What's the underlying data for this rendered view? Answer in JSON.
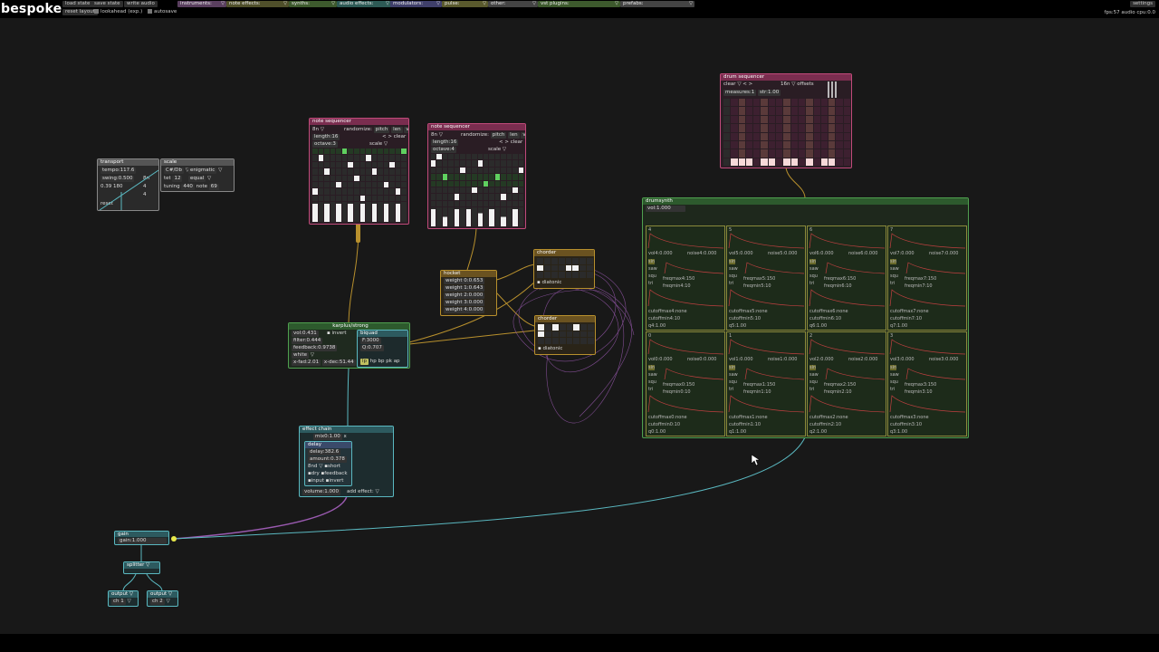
{
  "app": {
    "title": "bespoke"
  },
  "topbar": {
    "buttons": [
      "load state",
      "save state",
      "write audio",
      "reset layout"
    ],
    "checkboxes": [
      "lookahead (exp.)",
      "autosave"
    ],
    "categories": [
      {
        "label": "instruments:",
        "color": "#5a3f5f"
      },
      {
        "label": "note effects:",
        "color": "#4f4f2a"
      },
      {
        "label": "synths:",
        "color": "#3d5a2d"
      },
      {
        "label": "audio effects:",
        "color": "#2d5a55"
      },
      {
        "label": "modulators:",
        "color": "#3f3f6a"
      },
      {
        "label": "pulse:",
        "color": "#5a5a2d"
      },
      {
        "label": "other:",
        "color": "#444444"
      },
      {
        "label": "vst plugins:",
        "color": "#3d5a2d"
      },
      {
        "label": "prefabs:",
        "color": "#444444"
      }
    ],
    "settings_label": "settings",
    "status": "fps:57  audio cpu:0.0"
  },
  "transport": {
    "title": "transport",
    "tempo": "tempo:117.6",
    "swing": "swing:0.500",
    "time": "0.39 180",
    "div": "8n",
    "n1": "4",
    "n2": "4",
    "reset": "reset"
  },
  "scale": {
    "title": "scale",
    "root": "C#/Db",
    "scale": "enigmatic",
    "tet": "tet",
    "tet_val": "12",
    "tuning_mode": "equal",
    "tuning": "tuning",
    "tuning_val": "440",
    "note": "note",
    "note_val": "69"
  },
  "seq1": {
    "title": "note sequencer",
    "interval": "8n",
    "randomize": "randomize:",
    "pitch": "pitch",
    "len": "len",
    "vel": "vel",
    "length": "length:16",
    "octave": "octave:3",
    "clear": "clear",
    "mode": "scale"
  },
  "seq2": {
    "title": "note sequencer",
    "interval": "8n",
    "randomize": "randomize:",
    "pitch": "pitch",
    "len": "len",
    "vel": "vel",
    "length": "length:16",
    "octave": "octave:4",
    "clear": "clear",
    "mode": "scale"
  },
  "drum_sequencer": {
    "title": "drum sequencer",
    "clear": "clear",
    "interval": "16n",
    "offsets": "offsets",
    "measures": "measures:1",
    "str": "str:1.00"
  },
  "hocket": {
    "title": "hocket",
    "weights": [
      "weight 0:0.653",
      "weight 1:0.643",
      "weight 2:0.000",
      "weight 3:0.000",
      "weight 4:0.000"
    ]
  },
  "chorder1": {
    "title": "chorder",
    "diatonic": "diatonic"
  },
  "chorder2": {
    "title": "chorder",
    "diatonic": "diatonic"
  },
  "karplus": {
    "title": "karplus/strong",
    "vol": "vol:0.431",
    "invert": "invert",
    "filter": "filter:0.444",
    "feedback": "feedback:0.9738",
    "source": "white",
    "xfade": "x-fad:2.01",
    "xdecay": "x-dec:51.44"
  },
  "biquad": {
    "title": "biquad",
    "f": "F:3000",
    "q": "Q:0.707",
    "modes": [
      "lp",
      "hp",
      "bp",
      "pk",
      "ap"
    ]
  },
  "drumsynth": {
    "title": "drumsynth",
    "vol": "vol:1.000",
    "waves": [
      "sin",
      "saw",
      "squ",
      "tri"
    ],
    "pads": [
      {
        "id": "4",
        "vol": "vol4:0.000",
        "noise": "noise4:0.000",
        "freqmax": "freqmax4:150",
        "freqmin": "freqmin4:10",
        "cutmax": "cutoffmax4:none",
        "cutmin": "cutoffmin4:10",
        "q": "q4:1.00"
      },
      {
        "id": "5",
        "vol": "vol5:0.000",
        "noise": "noise5:0.000",
        "freqmax": "freqmax5:150",
        "freqmin": "freqmin5:10",
        "cutmax": "cutoffmax5:none",
        "cutmin": "cutoffmin5:10",
        "q": "q5:1.00"
      },
      {
        "id": "6",
        "vol": "vol6:0.000",
        "noise": "noise6:0.000",
        "freqmax": "freqmax6:150",
        "freqmin": "freqmin6:10",
        "cutmax": "cutoffmax6:none",
        "cutmin": "cutoffmin6:10",
        "q": "q6:1.00"
      },
      {
        "id": "7",
        "vol": "vol7:0.000",
        "noise": "noise7:0.000",
        "freqmax": "freqmax7:150",
        "freqmin": "freqmin7:10",
        "cutmax": "cutoffmax7:none",
        "cutmin": "cutoffmin7:10",
        "q": "q7:1.00"
      },
      {
        "id": "0",
        "vol": "vol0:0.000",
        "noise": "noise0:0.000",
        "freqmax": "freqmax0:150",
        "freqmin": "freqmin0:10",
        "cutmax": "cutoffmax0:none",
        "cutmin": "cutoffmin0:10",
        "q": "q0:1.00"
      },
      {
        "id": "1",
        "vol": "vol1:0.000",
        "noise": "noise1:0.000",
        "freqmax": "freqmax1:150",
        "freqmin": "freqmin1:10",
        "cutmax": "cutoffmax1:none",
        "cutmin": "cutoffmin1:10",
        "q": "q1:1.00"
      },
      {
        "id": "2",
        "vol": "vol2:0.000",
        "noise": "noise2:0.000",
        "freqmax": "freqmax2:150",
        "freqmin": "freqmin2:10",
        "cutmax": "cutoffmax2:none",
        "cutmin": "cutoffmin2:10",
        "q": "q2:1.00"
      },
      {
        "id": "3",
        "vol": "vol3:0.000",
        "noise": "noise3:0.000",
        "freqmax": "freqmax3:150",
        "freqmin": "freqmin3:10",
        "cutmax": "cutoffmax3:none",
        "cutmin": "cutoffmin3:10",
        "q": "q3:1.00"
      }
    ]
  },
  "effectchain": {
    "title": "effect chain",
    "mix": "mix0:1.00",
    "delay_title": "delay",
    "delay": "delay:382.6",
    "amount": "amount:0.378",
    "interval": "8nd",
    "short": "short",
    "dry": "dry",
    "feedback": "feedback",
    "input": "input",
    "invert": "invert",
    "volume": "volume:1.000",
    "add_effect": "add effect:"
  },
  "gain": {
    "title": "gain",
    "value": "gain:1.000"
  },
  "splitter": {
    "title": "splitter"
  },
  "output1": {
    "title": "output",
    "ch": "ch 1"
  },
  "output2": {
    "title": "output",
    "ch": "ch 2"
  },
  "colors": {
    "canvas": "#181818",
    "note_module": "#c04a7a",
    "synth_module": "#4fa04f",
    "audio_module": "#5ab8c0",
    "pulse_module": "#b8902d",
    "wire_audio": "#5ab8c0",
    "wire_note": "#b8902d",
    "wire_purple": "#9a5ab0"
  }
}
